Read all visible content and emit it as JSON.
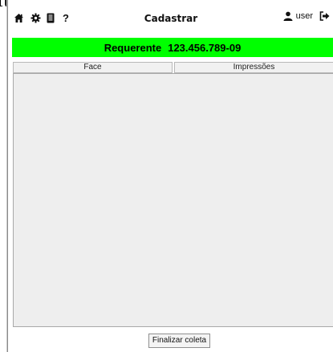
{
  "background_text": "ites:",
  "header": {
    "title": "Cadastrar",
    "user_label": "user",
    "icons": [
      "home-icon",
      "gear-icon",
      "book-icon",
      "help-icon",
      "user-icon",
      "logout-icon"
    ],
    "help_glyph": "?"
  },
  "banner": {
    "label": "Requerente",
    "cpf": "123.456.789-09",
    "color": "#00ff00"
  },
  "tabs": [
    {
      "label": "Face"
    },
    {
      "label": "Impressões"
    }
  ],
  "actions": {
    "finalize_label": "Finalizar coleta"
  }
}
